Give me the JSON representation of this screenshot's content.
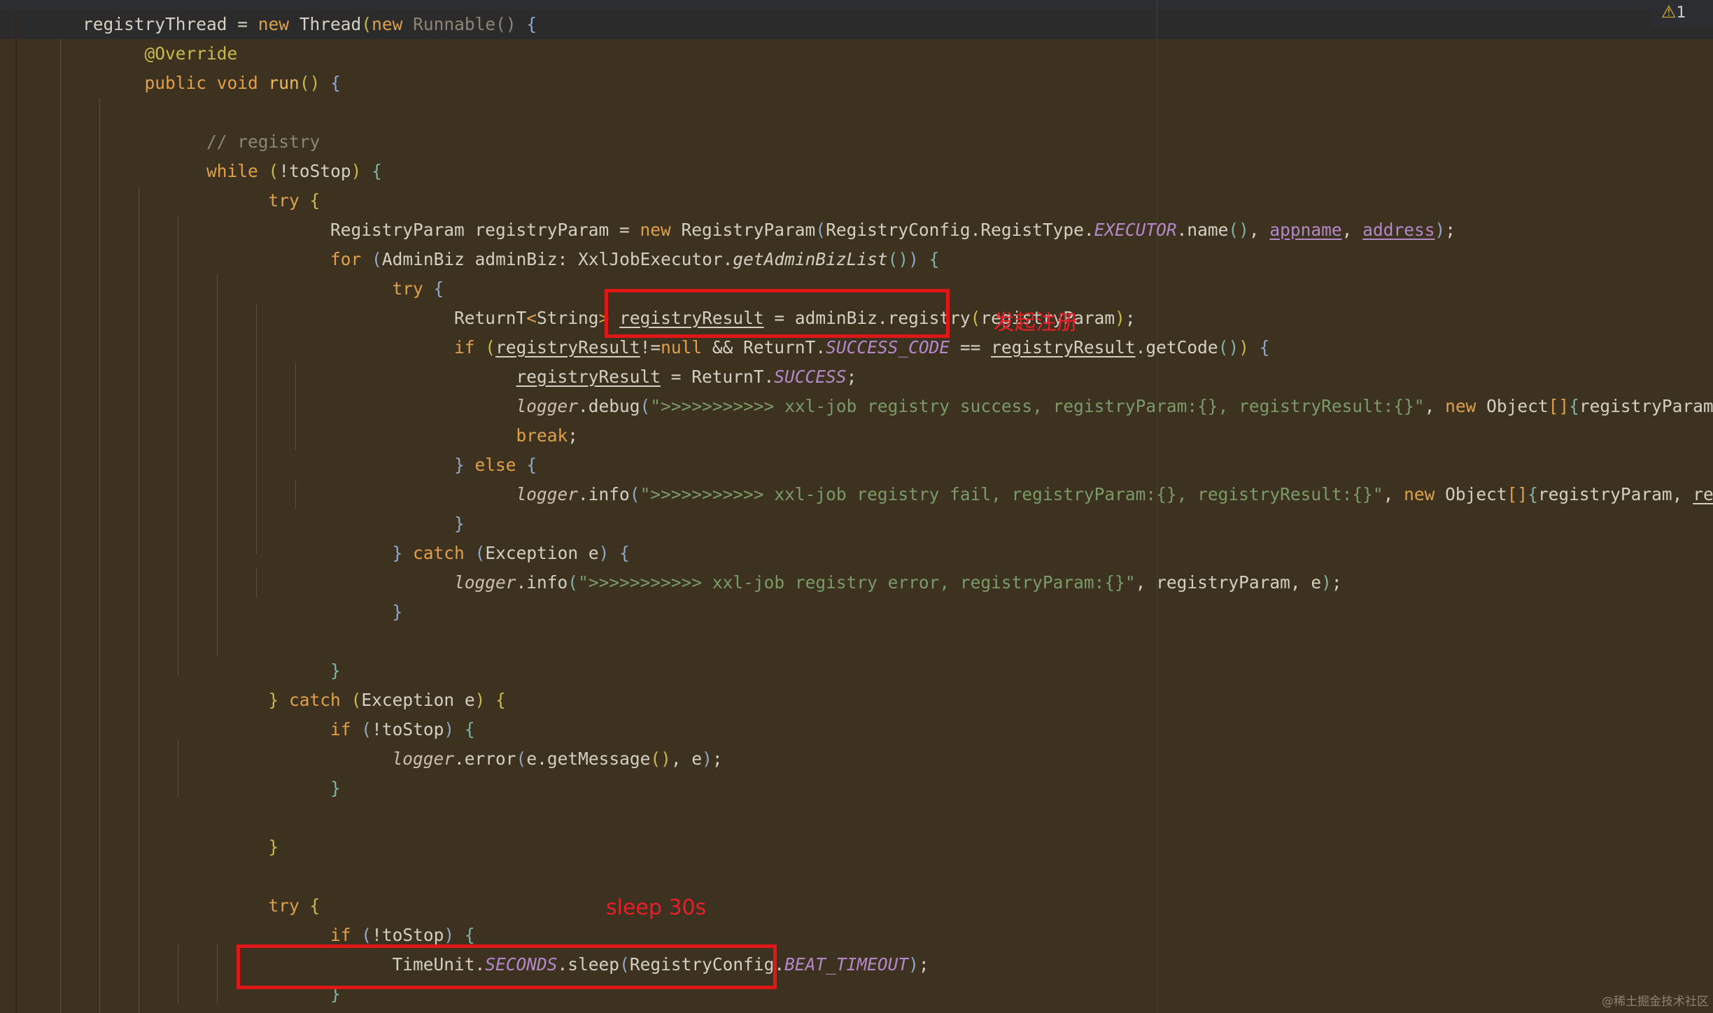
{
  "annotations": {
    "register_label": "发起注册",
    "sleep_label": "sleep 30s"
  },
  "inspection": {
    "warning_count": "1"
  },
  "watermark": "@稀土掘金技术社区",
  "colors": {
    "background": "#3d3220",
    "keyword": "#e0a04a",
    "annotation_red": "#e01717",
    "string": "#7a9a6a",
    "static_field": "#b388c8"
  }
}
